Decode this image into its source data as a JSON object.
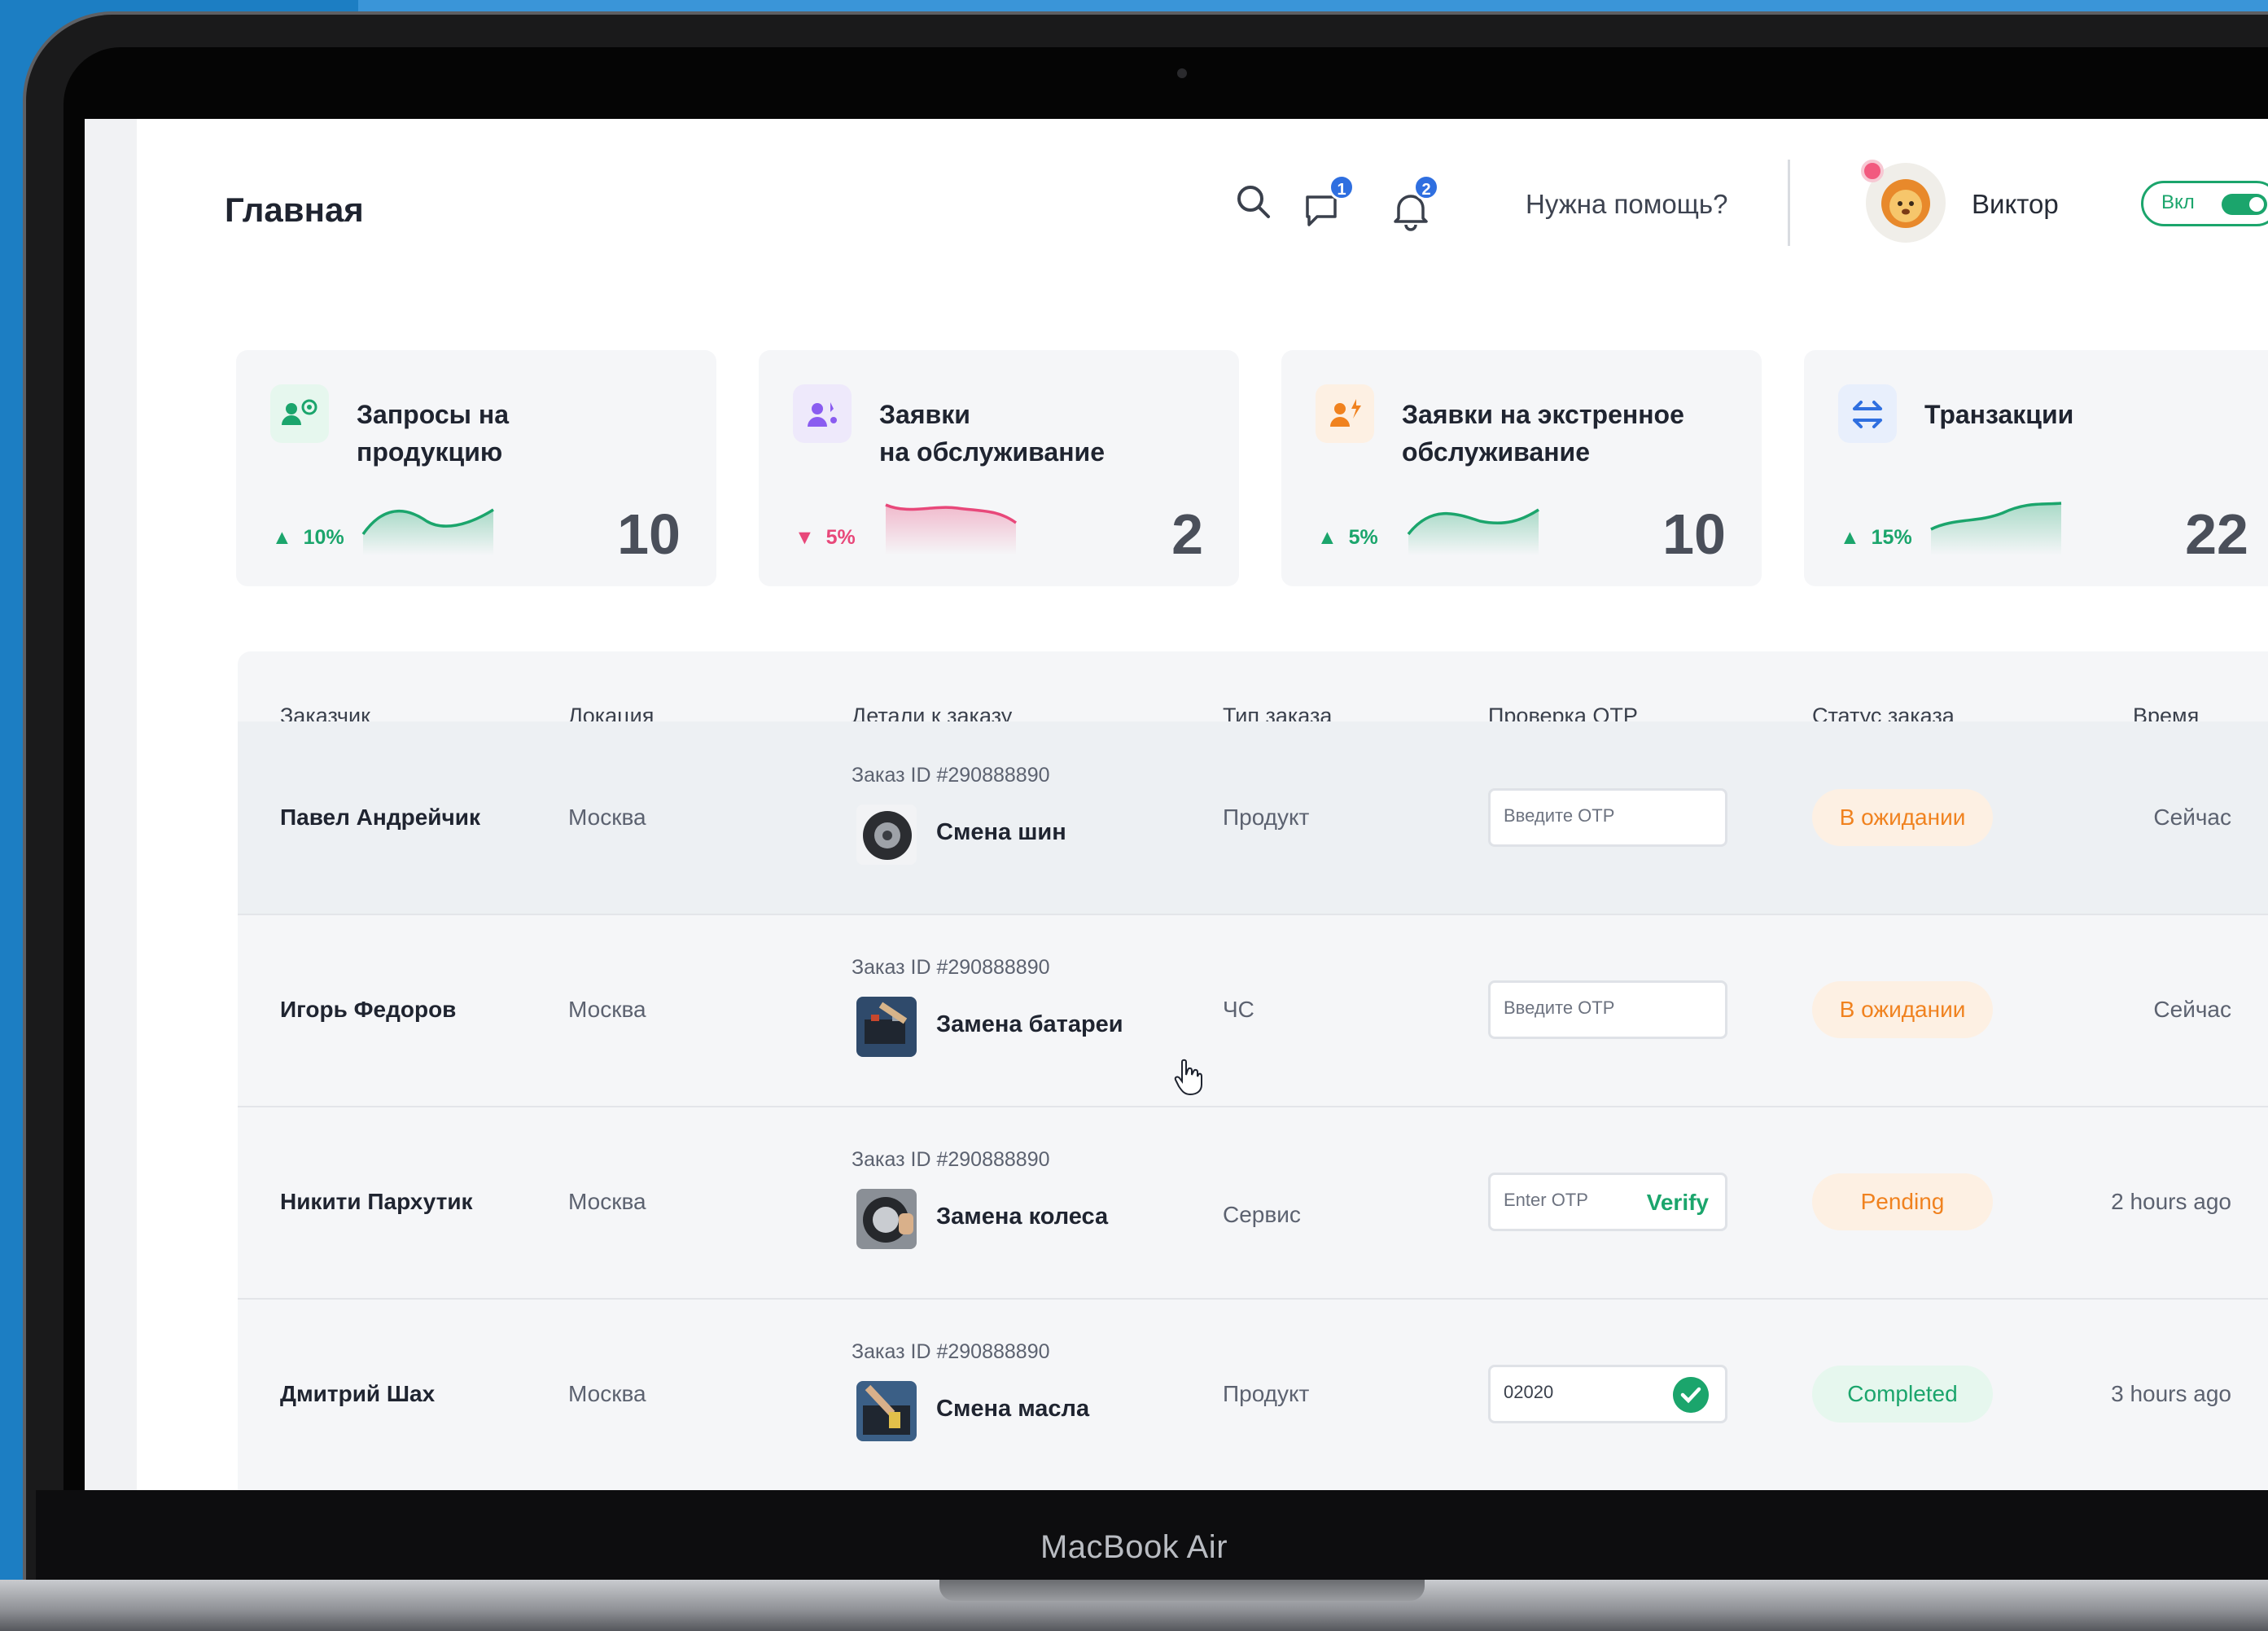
{
  "device_label": "MacBook Air",
  "header": {
    "title": "Главная",
    "chat_badge": "1",
    "notif_badge": "2",
    "help": "Нужна помощь?",
    "user_name": "Виктор",
    "toggle_label": "Вкл"
  },
  "stats": [
    {
      "title": "Запросы на\nпродукцию",
      "trend": "10%",
      "direction": "up",
      "value": "10",
      "icon": "users-icon",
      "color": "#1ba56c"
    },
    {
      "title": "Заявки\nна обслуживание",
      "trend": "5%",
      "direction": "down",
      "value": "2",
      "icon": "users-service-icon",
      "color": "#e8487a"
    },
    {
      "title": "Заявки на экстренное\nобслуживание",
      "trend": "5%",
      "direction": "up",
      "value": "10",
      "icon": "user-emergency-icon",
      "color": "#1ba56c"
    },
    {
      "title": "Транзакции",
      "trend": "15%",
      "direction": "up",
      "value": "22",
      "icon": "transfer-icon",
      "color": "#1ba56c"
    }
  ],
  "table": {
    "columns": [
      "Заказчик",
      "Локация",
      "Детали к заказу",
      "Тип заказа",
      "Проверка OTP",
      "Статус заказа",
      "Время"
    ],
    "rows": [
      {
        "customer": "Павел Андрейчик",
        "location": "Москва",
        "order_id": "Заказ ID #290888890",
        "order_name": "Смена шин",
        "thumb": "tire-photo",
        "type": "Продукт",
        "otp_placeholder": "Введите OTP",
        "otp_value": "",
        "otp_action": "",
        "status": "В ожидании",
        "status_kind": "pending",
        "time": "Сейчас"
      },
      {
        "customer": "Игорь Федоров",
        "location": "Москва",
        "order_id": "Заказ ID #290888890",
        "order_name": "Замена батареи",
        "thumb": "battery-photo",
        "type": "ЧС",
        "otp_placeholder": "Введите OTP",
        "otp_value": "",
        "otp_action": "",
        "status": "В ожидании",
        "status_kind": "pending",
        "time": "Сейчас"
      },
      {
        "customer": "Никити Пархутик",
        "location": "Москва",
        "order_id": "Заказ ID #290888890",
        "order_name": "Замена колеса",
        "thumb": "wheel-photo",
        "type": "Сервис",
        "otp_placeholder": "Enter OTP",
        "otp_value": "",
        "otp_action": "Verify",
        "status": "Pending",
        "status_kind": "pending",
        "time": "2 hours ago"
      },
      {
        "customer": "Дмитрий Шах",
        "location": "Москва",
        "order_id": "Заказ ID #290888890",
        "order_name": "Смена масла",
        "thumb": "oil-photo",
        "type": "Продукт",
        "otp_placeholder": "",
        "otp_value": "02020",
        "otp_action": "verified",
        "status": "Completed",
        "status_kind": "done",
        "time": "3 hours ago"
      }
    ]
  },
  "colors": {
    "accent": "#1ba56c",
    "down": "#e8487a",
    "pending": "#f0821f",
    "badge": "#2f6fe0"
  }
}
